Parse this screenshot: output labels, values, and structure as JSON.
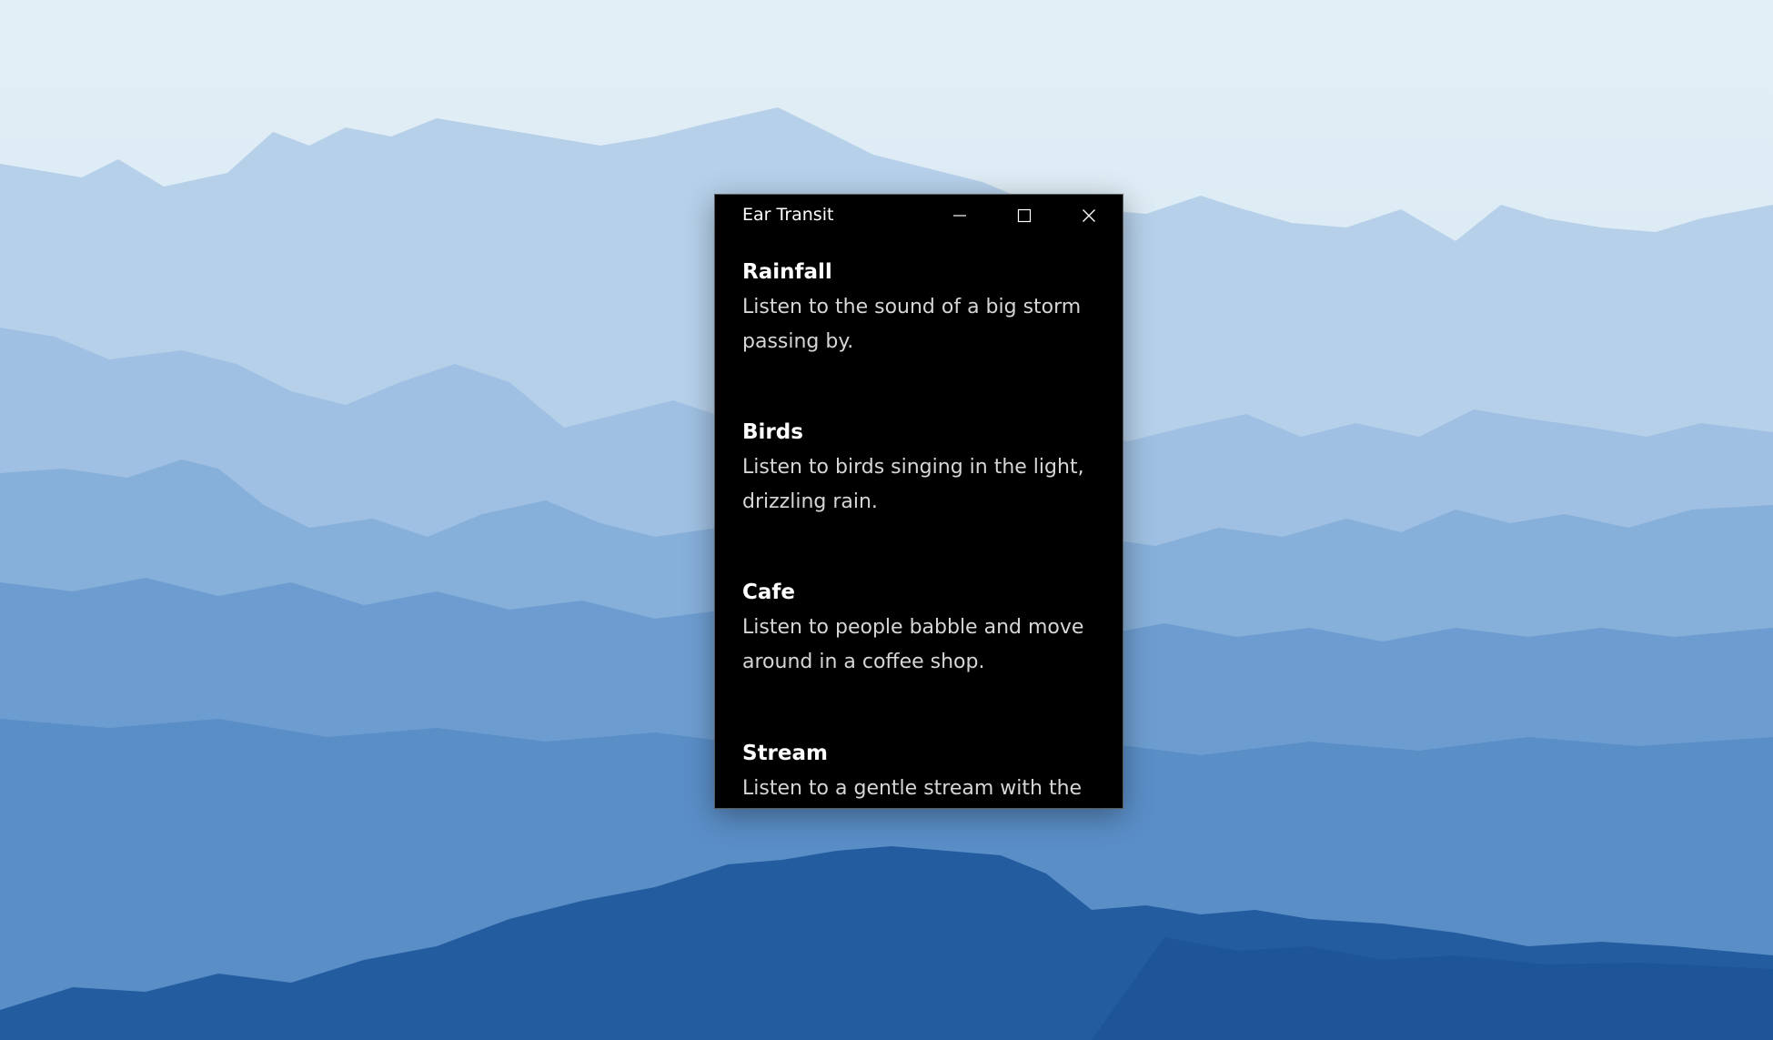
{
  "window": {
    "title": "Ear Transit",
    "minimize_icon": "minimize-icon",
    "maximize_icon": "maximize-icon",
    "close_icon": "close-icon"
  },
  "sounds": [
    {
      "title": "Rainfall",
      "description": "Listen to the sound of a big storm passing by."
    },
    {
      "title": "Birds",
      "description": "Listen to birds singing in the light, drizzling rain."
    },
    {
      "title": "Cafe",
      "description": "Listen to people babble and move around in a coffee shop."
    },
    {
      "title": "Stream",
      "description": "Listen to a gentle stream with the"
    }
  ],
  "colors": {
    "window_bg": "#000000",
    "title_text": "#ffffff",
    "description_text": "#d6d6d6"
  }
}
